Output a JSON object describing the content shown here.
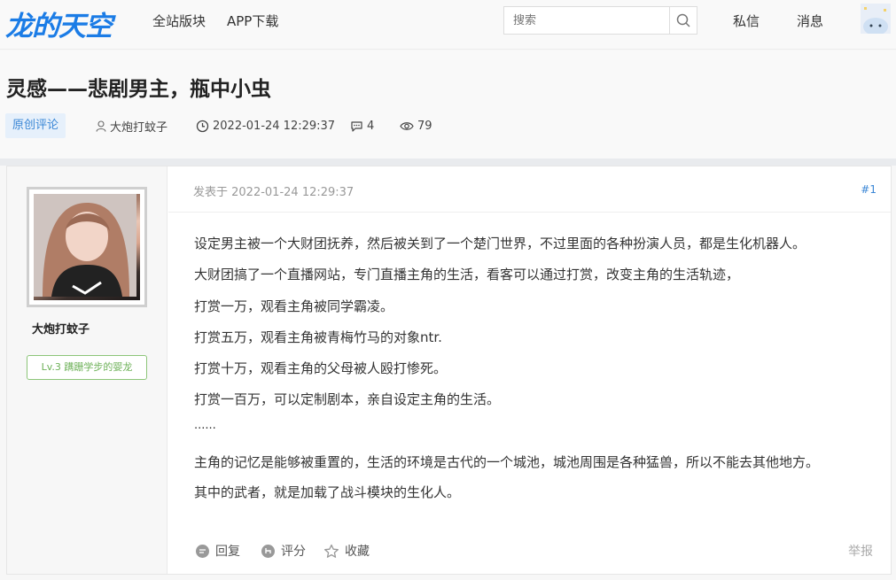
{
  "header": {
    "logo": "龙的天空",
    "nav": [
      "全站版块",
      "APP下载"
    ],
    "search_placeholder": "搜索",
    "private_msg": "私信",
    "messages": "消息"
  },
  "thread": {
    "title": "灵感——悲剧男主，瓶中小虫",
    "category": "原创评论",
    "author": "大炮打蚊子",
    "datetime": "2022-01-24 12:29:37",
    "comments": "4",
    "views": "79"
  },
  "post": {
    "user": {
      "name": "大炮打蚊子",
      "level": "Lv.3 蹒跚学步的婴龙"
    },
    "posted_at": "发表于 2022-01-24 12:29:37",
    "floor": "#1",
    "lines": [
      "设定男主被一个大财团抚养，然后被关到了一个楚门世界，不过里面的各种扮演人员，都是生化机器人。",
      "大财团搞了一个直播网站，专门直播主角的生活，看客可以通过打赏，改变主角的生活轨迹，",
      "打赏一万，观看主角被同学霸凌。",
      "打赏五万，观看主角被青梅竹马的对象ntr.",
      "打赏十万，观看主角的父母被人殴打惨死。",
      "打赏一百万，可以定制剧本，亲自设定主角的生活。",
      "......",
      "主角的记忆是能够被重置的，生活的环境是古代的一个城池，城池周围是各种猛兽，所以不能去其他地方。",
      "其中的武者，就是加载了战斗模块的生化人。"
    ],
    "actions": {
      "reply": "回复",
      "rate": "评分",
      "favorite": "收藏",
      "report": "举报"
    }
  }
}
